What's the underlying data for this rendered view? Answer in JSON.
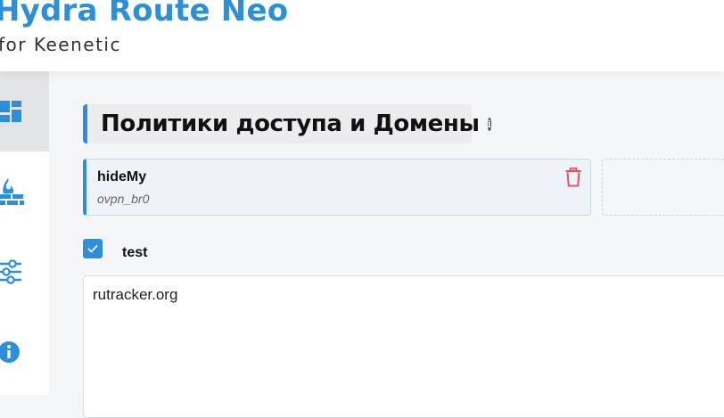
{
  "header": {
    "title": "Hydra Route Neo",
    "subtitle": "for Keenetic"
  },
  "sidebar": {
    "items": [
      {
        "icon": "dashboard-icon",
        "active": true
      },
      {
        "icon": "firewall-icon",
        "active": false
      },
      {
        "icon": "settings-sliders-icon",
        "active": false
      },
      {
        "icon": "info-icon",
        "active": false
      }
    ]
  },
  "main": {
    "section_title": "Политики доступа и Домены",
    "info_icon": "i",
    "policy": {
      "name": "hideMy",
      "interface": "ovpn_br0"
    },
    "group": {
      "checked": true,
      "label": "test",
      "domains": "rutracker.org"
    }
  },
  "colors": {
    "accent": "#2d8fd8",
    "danger": "#e2545f"
  }
}
